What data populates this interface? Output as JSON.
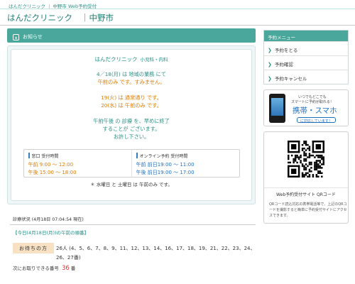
{
  "topbar": {
    "name": "はんだクリニック",
    "city": "中野市",
    "service": "Web予約受付"
  },
  "header": {
    "name": "はんだクリニック",
    "city": "｜中野市"
  },
  "notice": {
    "title": "お知らせ",
    "clinic": "はんだクリニック",
    "departments": "小児科・内科",
    "lines": [
      {
        "text": "4／18(月) は 地域の業務 にて",
        "color": "normal"
      },
      {
        "text": "午前のみ です。すみません。",
        "color": "orange"
      },
      {
        "text": "",
        "color": "normal"
      },
      {
        "text": "19(火) は 通常通り です。",
        "color": "orange"
      },
      {
        "text": "20(水) は 午前のみ です。",
        "color": "orange"
      },
      {
        "text": "",
        "color": "normal"
      },
      {
        "text": "午前午後 の 診療 を、早めに終了",
        "color": "normal"
      },
      {
        "text": "することが ございます。",
        "color": "normal"
      },
      {
        "text": "お許し下さい。",
        "color": "normal"
      }
    ],
    "hours": {
      "window": {
        "title": "窓口 受付時間",
        "am": "午前  9:00 ～ 12:00",
        "pm": "午後 15:00 ～ 18:00"
      },
      "online": {
        "title": "オンライン予約 受付時間",
        "am": "午前 前日19:00 ～ 11:00",
        "pm": "午後 前日19:00 ～ 17:00"
      }
    },
    "holiday": "＊ 水曜日 と 土曜日 は 午前のみ です。"
  },
  "status": {
    "title": "診療状況 (4月18日 07:04:54 現在)",
    "today": "【今日(4月18日(月))の午前の順番】",
    "waiting_label": "お待ちの方",
    "waiting_text": "26人 (4、5、6、7、8、9、11、12、13、14、16、17、18、19、21、22、23、24、26、27番)",
    "next_prefix": "次にお取りできる番号",
    "next_number": "36",
    "next_suffix": "番"
  },
  "sidebar": {
    "title": "予約メニュー",
    "items": [
      {
        "label": "予約をとる"
      },
      {
        "label": "予約確認"
      },
      {
        "label": "予約キャンセル"
      }
    ],
    "banner": {
      "line1": "いつでもどこでも",
      "line2": "スマートに予約が取れる！",
      "big": "携帯・スマホ",
      "small": "に対応しています！"
    },
    "qr_caption": "Web予約受付サイト QRコード",
    "qr_desc": "QRコード読込対応の携帯電話等で、上記のQRコードを撮影すると簡単に予約受付サイトにアクセスできます。"
  },
  "colors": {
    "accent": "#4aa79c",
    "orange": "#e07b00",
    "blue": "#1f6fc0",
    "red": "#e03030"
  }
}
